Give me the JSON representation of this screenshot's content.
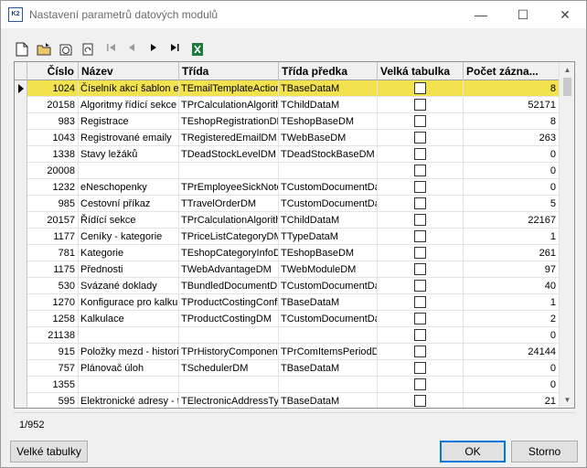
{
  "window": {
    "icon_text": "K2",
    "title": "Nastavení parametrů datových modulů",
    "minimize_glyph": "—",
    "maximize_glyph": "☐",
    "close_glyph": "✕"
  },
  "toolbar": {
    "icons": [
      "new-document-icon",
      "open-folder-icon",
      "open-folder-refresh-icon",
      "refresh-icon",
      "first-record-icon",
      "previous-record-icon",
      "next-record-icon",
      "last-record-icon",
      "excel-export-icon"
    ]
  },
  "grid": {
    "columns": [
      "Číslo",
      "Název",
      "Třída",
      "Třída předka",
      "Velká tabulka",
      "Počet zázna..."
    ],
    "rows": [
      {
        "cislo": "1024",
        "nazev": "Číselník akcí šablon em",
        "trida": "TEmailTemplateActionD",
        "predek": "TBaseDataM",
        "pocet": "8"
      },
      {
        "cislo": "20158",
        "nazev": "Algoritmy řídící sekce",
        "trida": "TPrCalculationAlgorithm",
        "predek": "TChildDataM",
        "pocet": "52171"
      },
      {
        "cislo": "983",
        "nazev": "Registrace",
        "trida": "TEshopRegistrationDM",
        "predek": "TEshopBaseDM",
        "pocet": "8"
      },
      {
        "cislo": "1043",
        "nazev": "Registrované emaily",
        "trida": "TRegisteredEmailDM",
        "predek": "TWebBaseDM",
        "pocet": "263"
      },
      {
        "cislo": "1338",
        "nazev": "Stavy ležáků",
        "trida": "TDeadStockLevelDM",
        "predek": "TDeadStockBaseDM",
        "pocet": "0"
      },
      {
        "cislo": "20008",
        "nazev": "",
        "trida": "",
        "predek": "",
        "pocet": "0"
      },
      {
        "cislo": "1232",
        "nazev": "eNeschopenky",
        "trida": "TPrEmployeeSickNoteD",
        "predek": "TCustomDocumentDat",
        "pocet": "0"
      },
      {
        "cislo": "985",
        "nazev": "Cestovní příkaz",
        "trida": "TTravelOrderDM",
        "predek": "TCustomDocumentDat",
        "pocet": "5"
      },
      {
        "cislo": "20157",
        "nazev": "Řídící sekce",
        "trida": "TPrCalculationAlgorithm",
        "predek": "TChildDataM",
        "pocet": "22167"
      },
      {
        "cislo": "1177",
        "nazev": "Ceníky - kategorie",
        "trida": "TPriceListCategoryDM",
        "predek": "TTypeDataM",
        "pocet": "1"
      },
      {
        "cislo": "781",
        "nazev": "Kategorie",
        "trida": "TEshopCategoryInfoD",
        "predek": "TEshopBaseDM",
        "pocet": "261"
      },
      {
        "cislo": "1175",
        "nazev": "Přednosti",
        "trida": "TWebAdvantageDM",
        "predek": "TWebModuleDM",
        "pocet": "97"
      },
      {
        "cislo": "530",
        "nazev": "Svázané doklady",
        "trida": "TBundledDocumentDM",
        "predek": "TCustomDocumentDat",
        "pocet": "40"
      },
      {
        "cislo": "1270",
        "nazev": "Konfigurace pro kalkula",
        "trida": "TProductCostingConfig",
        "predek": "TBaseDataM",
        "pocet": "1"
      },
      {
        "cislo": "1258",
        "nazev": "Kalkulace",
        "trida": "TProductCostingDM",
        "predek": "TCustomDocumentDat",
        "pocet": "2"
      },
      {
        "cislo": "21138",
        "nazev": "",
        "trida": "",
        "predek": "",
        "pocet": "0"
      },
      {
        "cislo": "915",
        "nazev": "Položky mezd - historie",
        "trida": "TPrHistoryComponentD",
        "predek": "TPrComItemsPeriodDM",
        "pocet": "24144"
      },
      {
        "cislo": "757",
        "nazev": "Plánovač úloh",
        "trida": "TSchedulerDM",
        "predek": "TBaseDataM",
        "pocet": "0"
      },
      {
        "cislo": "1355",
        "nazev": "",
        "trida": "",
        "predek": "",
        "pocet": "0"
      },
      {
        "cislo": "595",
        "nazev": "Elektronické adresy - t",
        "trida": "TElectronicAddressTyp",
        "predek": "TBaseDataM",
        "pocet": "21"
      }
    ]
  },
  "status": {
    "record_position": "1/952"
  },
  "buttons": {
    "big_tables": "Velké tabulky",
    "ok": "OK",
    "cancel": "Storno"
  },
  "colors": {
    "selected_row": "#f2e24d",
    "default_button_border": "#0078d7"
  }
}
